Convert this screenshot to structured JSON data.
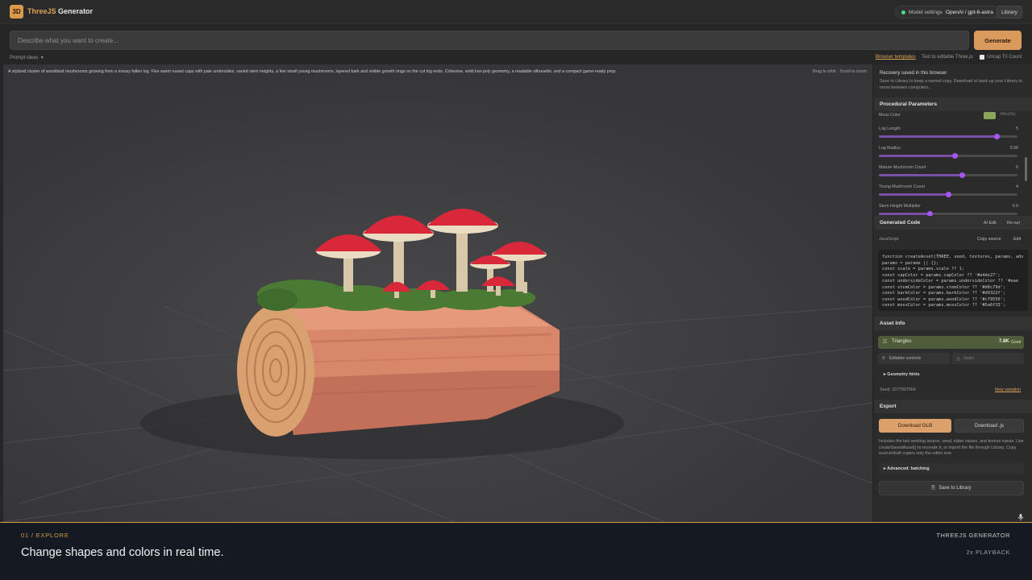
{
  "header": {
    "logo_text": "3D",
    "app_name_brand": "ThreeJS",
    "app_name_rest": "Generator",
    "model_settings_label": "Model settings",
    "model_settings_value": "OpenAI / gpt-6-astra",
    "library_label": "Library"
  },
  "prompt": {
    "placeholder": "Describe what you want to create...",
    "generate_label": "Generate",
    "prompt_ideas_label": "Prompt ideas",
    "browser_templates_label": "Browser templates",
    "text_editable_label": "Text to editable Three.js",
    "uncap_label": "Uncap Tri Count"
  },
  "viewport": {
    "prompt_text": "A stylized cluster of woodland mushrooms growing from a mossy fallen log. Five warm russet caps with pale undersides, varied stem heights, a few small young mushrooms, layered bark and visible growth rings on the cut log ends. Cohesive, solid low-poly geometry, a readable silhouette, and a compact game-ready prop.",
    "orbit_hint": "Drag to orbit · Scroll to zoom",
    "colors": {
      "cap": "#d9283a",
      "underside": "#eadcc2",
      "stem": "#d8c7a8",
      "bark": "#d9876a",
      "moss": "#4b7a34",
      "rings": "#d9a070"
    }
  },
  "panel": {
    "recovery_title": "Recovery saved in this browser",
    "recovery_text": "Save to Library to keep a named copy. Download or back up your Library to move between computers.",
    "params_title": "Procedural Parameters",
    "moss_color_label": "Moss Color",
    "moss_color_hex": "#8ba65a",
    "params": [
      {
        "label": "Log Length",
        "value": "5",
        "fraction": 0.85
      },
      {
        "label": "Log Radius",
        "value": "0.58",
        "fraction": 0.55
      },
      {
        "label": "Mature Mushroom Count",
        "value": "6",
        "fraction": 0.6
      },
      {
        "label": "Young Mushroom Count",
        "value": "4",
        "fraction": 0.5
      },
      {
        "label": "Stem Height Multiplier",
        "value": "0.9",
        "fraction": 0.37
      }
    ],
    "code_title": "Generated Code",
    "ai_edit_label": "AI Edit",
    "rerun_label": "Re-run",
    "language_label": "JavaScript",
    "copy_source_label": "Copy source",
    "edit_label": "Edit",
    "code_lines": [
      "function createAsset(THREE, seed, textures, params, adv",
      "  params = params || {};",
      "  const scale = params.scale ?? 1;",
      "  const capColor = params.capColor ?? '#a4de27';",
      "  const undersideColor = params.undersideColor ?? '#eae",
      "  const stemColor = params.stemColor ?? '#d8c79d';",
      "  const barkColor = params.barkColor ?? '#d9322f';",
      "  const woodColor = params.woodColor ?? '#c79550';",
      "  const mossColor = params.mossColor ?? '#5a6f33';"
    ],
    "asset_info_title": "Asset Info",
    "triangles_label": "Triangles",
    "triangles_value": "7.8K",
    "triangles_rating": "Good",
    "editable_controls_label": "Editable controls",
    "static_label": "Static",
    "geometry_hints_label": "Geometry hints",
    "seed_text": "Seed: 1077597564",
    "new_variation_label": "New variation",
    "export_title": "Export",
    "download_glb_label": "Download GLB",
    "download_js_label": "Download .js",
    "export_text": "Includes the last working source, seed, slider values, and texture inputs. Use createSavedAsset() to recreate it, or import the file through Library. Copy source/draft copies only the editor text.",
    "advanced_batching_label": "Advanced: batching",
    "save_to_library_label": "Save to Library"
  },
  "footer": {
    "step_label": "01 / EXPLORE",
    "caption": "Change shapes and colors in real time.",
    "brand_caps": "THREEJS GENERATOR",
    "playback": "2x PLAYBACK"
  }
}
